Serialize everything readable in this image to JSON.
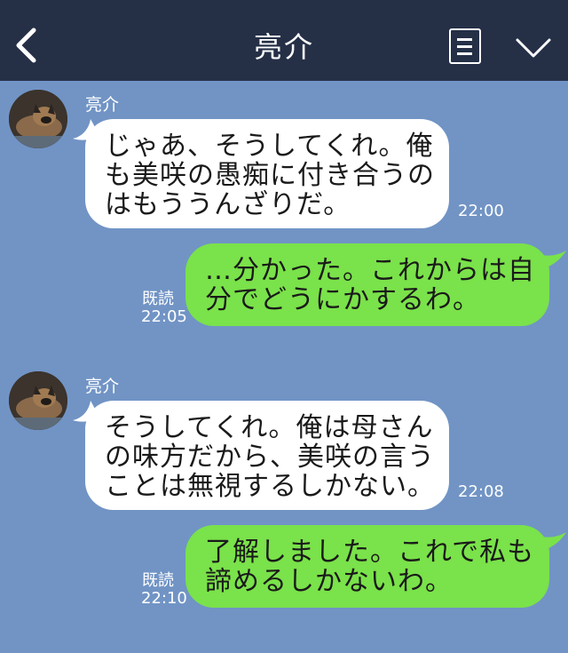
{
  "header": {
    "title": "亮介"
  },
  "messages": [
    {
      "direction": "incoming",
      "sender": "亮介",
      "text": "じゃあ、そうしてくれ。俺\nも美咲の愚痴に付き合うの\nはもううんざりだ。",
      "time": "22:00"
    },
    {
      "direction": "outgoing",
      "text": "…分かった。これからは自\n分でどうにかするわ。",
      "read": "既読",
      "time": "22:05"
    },
    {
      "direction": "incoming",
      "sender": "亮介",
      "text": "そうしてくれ。俺は母さん\nの味方だから、美咲の言う\nことは無視するしかない。",
      "time": "22:08"
    },
    {
      "direction": "outgoing",
      "text": "了解しました。これで私も\n諦めるしかないわ。",
      "read": "既読",
      "time": "22:10"
    }
  ],
  "colors": {
    "header_bg": "#253047",
    "chat_bg": "#7194c5",
    "incoming_bubble": "#ffffff",
    "outgoing_bubble": "#7ae24a"
  },
  "icons": {
    "back": "chevron-left-icon",
    "menu": "menu-icon",
    "collapse": "chevron-down-icon"
  }
}
